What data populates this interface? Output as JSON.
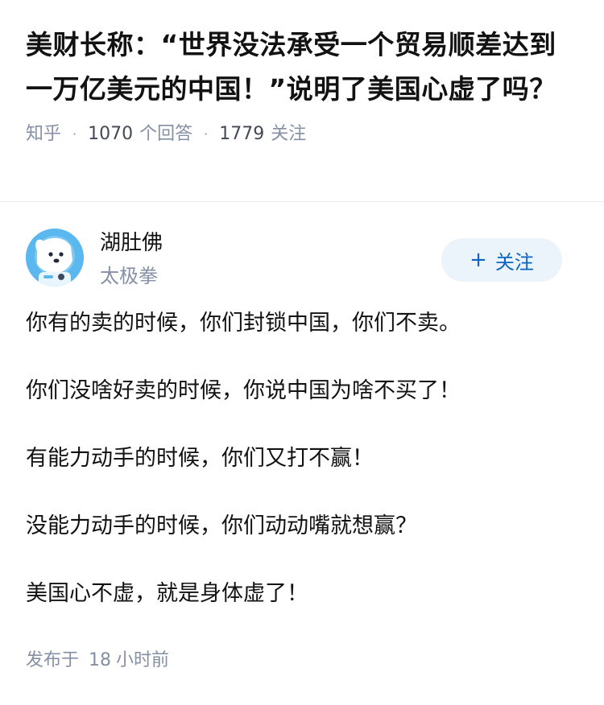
{
  "question": {
    "title": "美财长称：“世界没法承受一个贸易顺差达到一万亿美元的中国！”说明了美国心虚了吗？",
    "source": "知乎",
    "answers_count": "1070",
    "answers_label": "个回答",
    "followers_count": "1779",
    "followers_label": "关注"
  },
  "answer": {
    "author": {
      "name": "湖肚佛",
      "bio": "太极拳",
      "avatar_icon": "dog-astronaut-avatar-icon"
    },
    "follow_button": {
      "plus": "+",
      "label": "关注"
    },
    "paragraphs": [
      "你有的卖的时候，你们封锁中国，你们不卖。",
      "你们没啥好卖的时候，你说中国为啥不买了！",
      "有能力动手的时候，你们又打不赢！",
      "没能力动手的时候，你们动动嘴就想赢？",
      "美国心不虚，就是身体虚了！"
    ],
    "publish": {
      "prefix": "发布于",
      "value": "18",
      "unit": "小时前"
    }
  },
  "colors": {
    "accent": "#0a66c2",
    "follow_bg": "#ebf3fb",
    "meta": "#8590a6",
    "avatar_bg": "#5ab8ee"
  }
}
